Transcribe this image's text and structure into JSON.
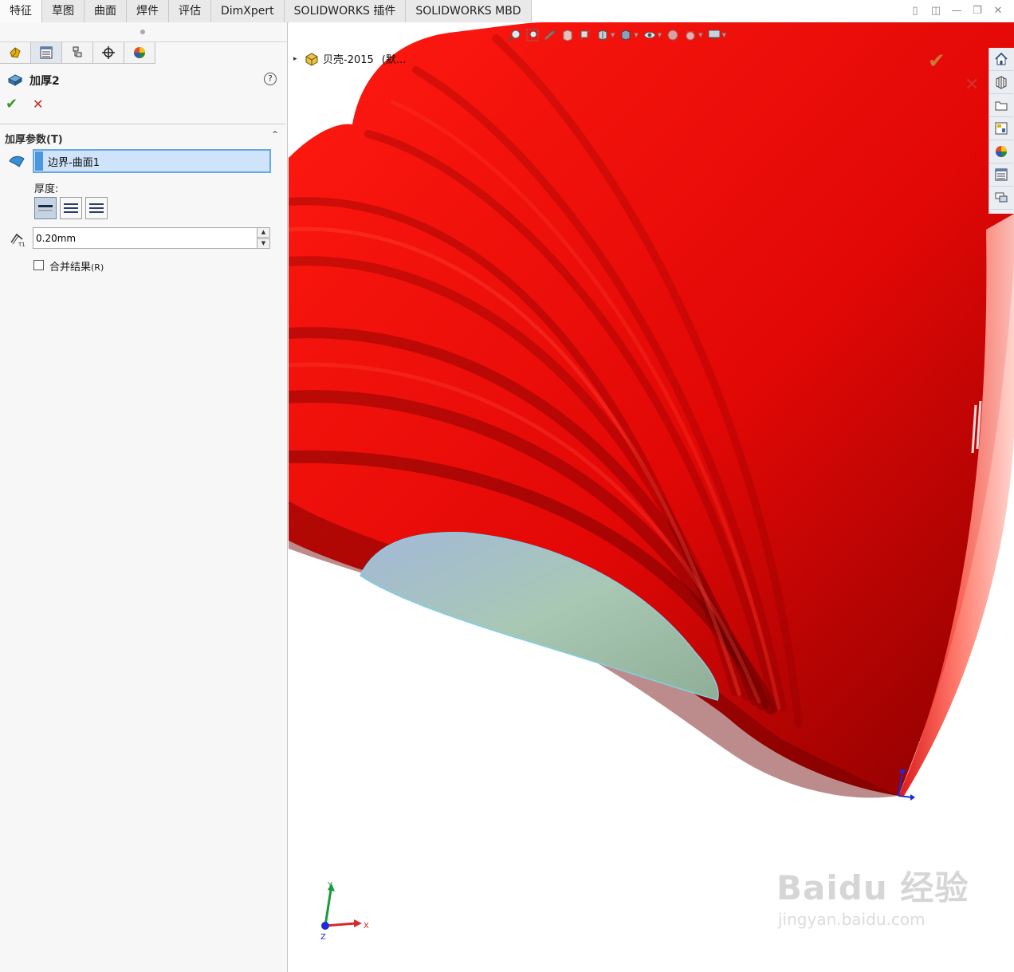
{
  "command_tabs": [
    "特征",
    "草图",
    "曲面",
    "焊件",
    "评估",
    "DimXpert",
    "SOLIDWORKS 插件",
    "SOLIDWORKS MBD"
  ],
  "property_manager": {
    "title": "加厚2",
    "help": "?",
    "ok_glyph": "✔",
    "cancel_glyph": "✕",
    "group_title": "加厚参数(T)",
    "collapse_glyph": "⌃",
    "face_selection": "边界-曲面1",
    "thickness_label": "厚度:",
    "thickness_value": "0.20mm",
    "spin_up": "▲",
    "spin_down": "▼",
    "merge_label": "合并结果",
    "merge_hotkey": "(R)",
    "merge_checked": false
  },
  "viewport": {
    "tree_arrow": "▸",
    "tree_title": "贝壳-2015",
    "tree_config": "(默...",
    "ok_glyph": "✔",
    "cancel_glyph": "✕",
    "triad": {
      "x": "X",
      "y": "Y",
      "z": "Z"
    }
  },
  "window_controls": [
    "▯",
    "◫",
    "—",
    "❐",
    "✕"
  ],
  "watermark": {
    "brand": "Baidu 经验",
    "url": "jingyan.baidu.com"
  },
  "colors": {
    "model_red": "#e00a06",
    "model_dark": "#7a0000",
    "inner_face": "#a9c9b8",
    "selection": "#cfe4fa",
    "accent_blue": "#4a96e0"
  }
}
